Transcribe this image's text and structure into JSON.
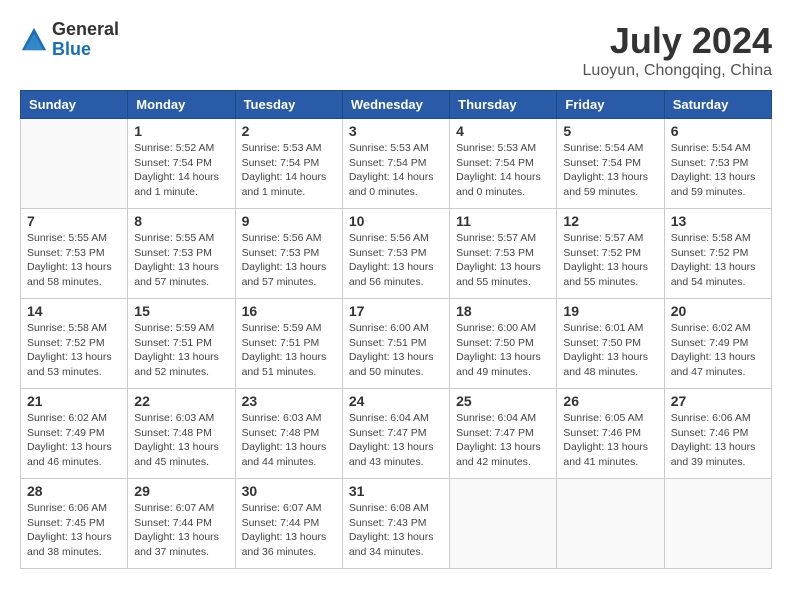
{
  "header": {
    "logo_general": "General",
    "logo_blue": "Blue",
    "month_title": "July 2024",
    "location": "Luoyun, Chongqing, China"
  },
  "days_of_week": [
    "Sunday",
    "Monday",
    "Tuesday",
    "Wednesday",
    "Thursday",
    "Friday",
    "Saturday"
  ],
  "weeks": [
    [
      {
        "day": "",
        "info": ""
      },
      {
        "day": "1",
        "info": "Sunrise: 5:52 AM\nSunset: 7:54 PM\nDaylight: 14 hours\nand 1 minute."
      },
      {
        "day": "2",
        "info": "Sunrise: 5:53 AM\nSunset: 7:54 PM\nDaylight: 14 hours\nand 1 minute."
      },
      {
        "day": "3",
        "info": "Sunrise: 5:53 AM\nSunset: 7:54 PM\nDaylight: 14 hours\nand 0 minutes."
      },
      {
        "day": "4",
        "info": "Sunrise: 5:53 AM\nSunset: 7:54 PM\nDaylight: 14 hours\nand 0 minutes."
      },
      {
        "day": "5",
        "info": "Sunrise: 5:54 AM\nSunset: 7:54 PM\nDaylight: 13 hours\nand 59 minutes."
      },
      {
        "day": "6",
        "info": "Sunrise: 5:54 AM\nSunset: 7:53 PM\nDaylight: 13 hours\nand 59 minutes."
      }
    ],
    [
      {
        "day": "7",
        "info": "Sunrise: 5:55 AM\nSunset: 7:53 PM\nDaylight: 13 hours\nand 58 minutes."
      },
      {
        "day": "8",
        "info": "Sunrise: 5:55 AM\nSunset: 7:53 PM\nDaylight: 13 hours\nand 57 minutes."
      },
      {
        "day": "9",
        "info": "Sunrise: 5:56 AM\nSunset: 7:53 PM\nDaylight: 13 hours\nand 57 minutes."
      },
      {
        "day": "10",
        "info": "Sunrise: 5:56 AM\nSunset: 7:53 PM\nDaylight: 13 hours\nand 56 minutes."
      },
      {
        "day": "11",
        "info": "Sunrise: 5:57 AM\nSunset: 7:53 PM\nDaylight: 13 hours\nand 55 minutes."
      },
      {
        "day": "12",
        "info": "Sunrise: 5:57 AM\nSunset: 7:52 PM\nDaylight: 13 hours\nand 55 minutes."
      },
      {
        "day": "13",
        "info": "Sunrise: 5:58 AM\nSunset: 7:52 PM\nDaylight: 13 hours\nand 54 minutes."
      }
    ],
    [
      {
        "day": "14",
        "info": "Sunrise: 5:58 AM\nSunset: 7:52 PM\nDaylight: 13 hours\nand 53 minutes."
      },
      {
        "day": "15",
        "info": "Sunrise: 5:59 AM\nSunset: 7:51 PM\nDaylight: 13 hours\nand 52 minutes."
      },
      {
        "day": "16",
        "info": "Sunrise: 5:59 AM\nSunset: 7:51 PM\nDaylight: 13 hours\nand 51 minutes."
      },
      {
        "day": "17",
        "info": "Sunrise: 6:00 AM\nSunset: 7:51 PM\nDaylight: 13 hours\nand 50 minutes."
      },
      {
        "day": "18",
        "info": "Sunrise: 6:00 AM\nSunset: 7:50 PM\nDaylight: 13 hours\nand 49 minutes."
      },
      {
        "day": "19",
        "info": "Sunrise: 6:01 AM\nSunset: 7:50 PM\nDaylight: 13 hours\nand 48 minutes."
      },
      {
        "day": "20",
        "info": "Sunrise: 6:02 AM\nSunset: 7:49 PM\nDaylight: 13 hours\nand 47 minutes."
      }
    ],
    [
      {
        "day": "21",
        "info": "Sunrise: 6:02 AM\nSunset: 7:49 PM\nDaylight: 13 hours\nand 46 minutes."
      },
      {
        "day": "22",
        "info": "Sunrise: 6:03 AM\nSunset: 7:48 PM\nDaylight: 13 hours\nand 45 minutes."
      },
      {
        "day": "23",
        "info": "Sunrise: 6:03 AM\nSunset: 7:48 PM\nDaylight: 13 hours\nand 44 minutes."
      },
      {
        "day": "24",
        "info": "Sunrise: 6:04 AM\nSunset: 7:47 PM\nDaylight: 13 hours\nand 43 minutes."
      },
      {
        "day": "25",
        "info": "Sunrise: 6:04 AM\nSunset: 7:47 PM\nDaylight: 13 hours\nand 42 minutes."
      },
      {
        "day": "26",
        "info": "Sunrise: 6:05 AM\nSunset: 7:46 PM\nDaylight: 13 hours\nand 41 minutes."
      },
      {
        "day": "27",
        "info": "Sunrise: 6:06 AM\nSunset: 7:46 PM\nDaylight: 13 hours\nand 39 minutes."
      }
    ],
    [
      {
        "day": "28",
        "info": "Sunrise: 6:06 AM\nSunset: 7:45 PM\nDaylight: 13 hours\nand 38 minutes."
      },
      {
        "day": "29",
        "info": "Sunrise: 6:07 AM\nSunset: 7:44 PM\nDaylight: 13 hours\nand 37 minutes."
      },
      {
        "day": "30",
        "info": "Sunrise: 6:07 AM\nSunset: 7:44 PM\nDaylight: 13 hours\nand 36 minutes."
      },
      {
        "day": "31",
        "info": "Sunrise: 6:08 AM\nSunset: 7:43 PM\nDaylight: 13 hours\nand 34 minutes."
      },
      {
        "day": "",
        "info": ""
      },
      {
        "day": "",
        "info": ""
      },
      {
        "day": "",
        "info": ""
      }
    ]
  ]
}
